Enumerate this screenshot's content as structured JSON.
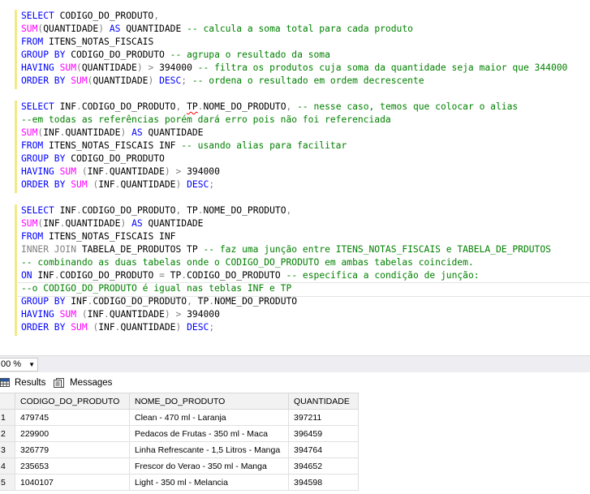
{
  "editor": {
    "lines": [
      [
        [
          "kw",
          "SELECT "
        ],
        [
          "t",
          "CODIGO_DO_PRODUTO"
        ],
        [
          "gray",
          ","
        ]
      ],
      [
        [
          "fn",
          "SUM"
        ],
        [
          "gray",
          "("
        ],
        [
          "t",
          "QUANTIDADE"
        ],
        [
          "gray",
          ") "
        ],
        [
          "kw",
          "AS "
        ],
        [
          "t",
          "QUANTIDADE "
        ],
        [
          "cm",
          "-- calcula a soma total para cada produto"
        ]
      ],
      [
        [
          "kw",
          "FROM "
        ],
        [
          "t",
          "ITENS_NOTAS_FISCAIS"
        ]
      ],
      [
        [
          "kw",
          "GROUP BY "
        ],
        [
          "t",
          "CODIGO_DO_PRODUTO "
        ],
        [
          "cm",
          "-- agrupa o resultado da soma"
        ]
      ],
      [
        [
          "kw",
          "HAVING "
        ],
        [
          "fn",
          "SUM"
        ],
        [
          "gray",
          "("
        ],
        [
          "t",
          "QUANTIDADE"
        ],
        [
          "gray",
          ") > "
        ],
        [
          "t",
          "394000 "
        ],
        [
          "cm",
          "-- filtra os produtos cuja soma da quantidade seja maior que 344000"
        ]
      ],
      [
        [
          "kw",
          "ORDER BY "
        ],
        [
          "fn",
          "SUM"
        ],
        [
          "gray",
          "("
        ],
        [
          "t",
          "QUANTIDADE"
        ],
        [
          "gray",
          ") "
        ],
        [
          "kw",
          "DESC"
        ],
        [
          "gray",
          "; "
        ],
        [
          "cm",
          "-- ordena o resultado em ordem decrescente"
        ]
      ],
      [],
      [
        [
          "kw",
          "SELECT "
        ],
        [
          "t",
          "INF"
        ],
        [
          "gray",
          "."
        ],
        [
          "t",
          "CODIGO_DO_PRODUTO"
        ],
        [
          "gray",
          ", "
        ],
        [
          "sq",
          "TP"
        ],
        [
          "gray",
          "."
        ],
        [
          "t",
          "NOME_DO_PRODUTO"
        ],
        [
          "gray",
          ", "
        ],
        [
          "cm",
          "-- nesse caso, temos que colocar o alias"
        ]
      ],
      [
        [
          "cm",
          "--em todas as referências porém dará erro pois não foi referenciada"
        ]
      ],
      [
        [
          "fn",
          "SUM"
        ],
        [
          "gray",
          "("
        ],
        [
          "t",
          "INF"
        ],
        [
          "gray",
          "."
        ],
        [
          "t",
          "QUANTIDADE"
        ],
        [
          "gray",
          ") "
        ],
        [
          "kw",
          "AS "
        ],
        [
          "t",
          "QUANTIDADE"
        ]
      ],
      [
        [
          "kw",
          "FROM "
        ],
        [
          "t",
          "ITENS_NOTAS_FISCAIS INF "
        ],
        [
          "cm",
          "-- usando alias para facilitar"
        ]
      ],
      [
        [
          "kw",
          "GROUP BY "
        ],
        [
          "t",
          "CODIGO_DO_PRODUTO"
        ]
      ],
      [
        [
          "kw",
          "HAVING "
        ],
        [
          "fn",
          "SUM "
        ],
        [
          "gray",
          "("
        ],
        [
          "t",
          "INF"
        ],
        [
          "gray",
          "."
        ],
        [
          "t",
          "QUANTIDADE"
        ],
        [
          "gray",
          ") > "
        ],
        [
          "t",
          "394000"
        ]
      ],
      [
        [
          "kw",
          "ORDER BY "
        ],
        [
          "fn",
          "SUM "
        ],
        [
          "gray",
          "("
        ],
        [
          "t",
          "INF"
        ],
        [
          "gray",
          "."
        ],
        [
          "t",
          "QUANTIDADE"
        ],
        [
          "gray",
          ") "
        ],
        [
          "kw",
          "DESC"
        ],
        [
          "gray",
          ";"
        ]
      ],
      [],
      [
        [
          "kw",
          "SELECT "
        ],
        [
          "t",
          "INF"
        ],
        [
          "gray",
          "."
        ],
        [
          "t",
          "CODIGO_DO_PRODUTO"
        ],
        [
          "gray",
          ", "
        ],
        [
          "t",
          "TP"
        ],
        [
          "gray",
          "."
        ],
        [
          "t",
          "NOME_DO_PRODUTO"
        ],
        [
          "gray",
          ","
        ]
      ],
      [
        [
          "fn",
          "SUM"
        ],
        [
          "gray",
          "("
        ],
        [
          "t",
          "INF"
        ],
        [
          "gray",
          "."
        ],
        [
          "t",
          "QUANTIDADE"
        ],
        [
          "gray",
          ") "
        ],
        [
          "kw",
          "AS "
        ],
        [
          "t",
          "QUANTIDADE"
        ]
      ],
      [
        [
          "kw",
          "FROM "
        ],
        [
          "t",
          "ITENS_NOTAS_FISCAIS INF"
        ]
      ],
      [
        [
          "gray",
          "INNER JOIN "
        ],
        [
          "t",
          "TABELA_DE_PRODUTOS TP "
        ],
        [
          "cm",
          "-- faz uma junção entre ITENS_NOTAS_FISCAIS e TABELA_DE_PRDUTOS"
        ]
      ],
      [
        [
          "cm",
          "-- combinando as duas tabelas onde o CODIGO_DO_PRODUTO em ambas tabelas coincidem."
        ]
      ],
      [
        [
          "kw",
          "ON "
        ],
        [
          "t",
          "INF"
        ],
        [
          "gray",
          "."
        ],
        [
          "t",
          "CODIGO_DO_PRODUTO "
        ],
        [
          "gray",
          "= "
        ],
        [
          "t",
          "TP"
        ],
        [
          "gray",
          "."
        ],
        [
          "t",
          "CODIGO_DO_PRODUTO "
        ],
        [
          "cm",
          "-- especifica a condição de junção:"
        ]
      ],
      [
        [
          "cm",
          "--o CODIGO_DO_PRODUTO é igual nas teblas INF e TP"
        ]
      ],
      [
        [
          "kw",
          "GROUP BY "
        ],
        [
          "t",
          "INF"
        ],
        [
          "gray",
          "."
        ],
        [
          "t",
          "CODIGO_DO_PRODUTO"
        ],
        [
          "gray",
          ", "
        ],
        [
          "t",
          "TP"
        ],
        [
          "gray",
          "."
        ],
        [
          "t",
          "NOME_DO_PRODUTO"
        ]
      ],
      [
        [
          "kw",
          "HAVING "
        ],
        [
          "fn",
          "SUM "
        ],
        [
          "gray",
          "("
        ],
        [
          "t",
          "INF"
        ],
        [
          "gray",
          "."
        ],
        [
          "t",
          "QUANTIDADE"
        ],
        [
          "gray",
          ") > "
        ],
        [
          "t",
          "394000"
        ]
      ],
      [
        [
          "kw",
          "ORDER BY "
        ],
        [
          "fn",
          "SUM "
        ],
        [
          "gray",
          "("
        ],
        [
          "t",
          "INF"
        ],
        [
          "gray",
          "."
        ],
        [
          "t",
          "QUANTIDADE"
        ],
        [
          "gray",
          ") "
        ],
        [
          "kw",
          "DESC"
        ],
        [
          "gray",
          ";"
        ]
      ]
    ]
  },
  "zoom": {
    "value": "00 %"
  },
  "tabs": {
    "results": "Results",
    "messages": "Messages"
  },
  "grid": {
    "headers": [
      "CODIGO_DO_PRODUTO",
      "NOME_DO_PRODUTO",
      "QUANTIDADE"
    ],
    "rows": [
      [
        "1",
        "479745",
        "Clean - 470 ml - Laranja",
        "397211"
      ],
      [
        "2",
        "229900",
        "Pedacos de Frutas - 350 ml - Maca",
        "396459"
      ],
      [
        "3",
        "326779",
        "Linha Refrescante - 1,5 Litros - Manga",
        "394764"
      ],
      [
        "4",
        "235653",
        "Frescor do Verao - 350 ml - Manga",
        "394652"
      ],
      [
        "5",
        "1040107",
        "Light - 350 ml - Melancia",
        "394598"
      ]
    ]
  },
  "colors": {
    "keyword": "#0000ff",
    "function": "#ff00ff",
    "comment": "#008000",
    "operator": "#808080",
    "results_tab_icon": "#2b579a"
  },
  "icons": {
    "results": "grid-icon",
    "messages": "messages-icon",
    "zoom": "chevron-down-icon"
  }
}
